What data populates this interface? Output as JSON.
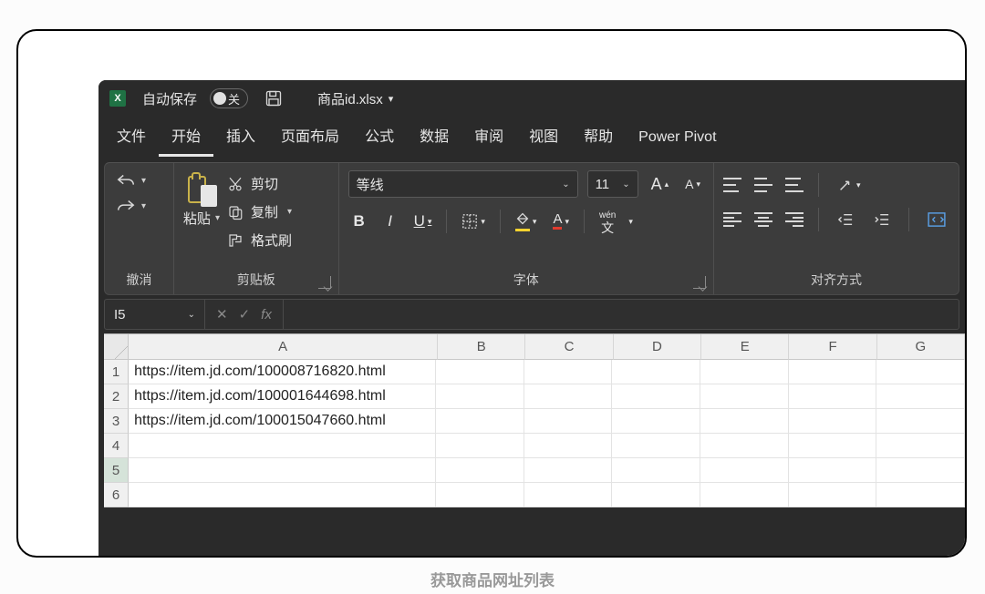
{
  "titlebar": {
    "autosave_label": "自动保存",
    "autosave_state": "关",
    "filename": "商品id.xlsx"
  },
  "tabs": [
    "文件",
    "开始",
    "插入",
    "页面布局",
    "公式",
    "数据",
    "审阅",
    "视图",
    "帮助",
    "Power Pivot"
  ],
  "active_tab": "开始",
  "ribbon": {
    "undo_group": "撤消",
    "clipboard": {
      "paste": "粘贴",
      "cut": "剪切",
      "copy": "复制",
      "format_painter": "格式刷",
      "group": "剪贴板"
    },
    "font": {
      "name": "等线",
      "size": "11",
      "phonetic": "wén",
      "group": "字体"
    },
    "alignment": {
      "group": "对齐方式"
    }
  },
  "formula_bar": {
    "cell_ref": "I5",
    "fx": "fx",
    "value": ""
  },
  "columns": [
    "A",
    "B",
    "C",
    "D",
    "E",
    "F",
    "G"
  ],
  "rows": [
    {
      "n": 1,
      "A": "https://item.jd.com/100008716820.html"
    },
    {
      "n": 2,
      "A": "https://item.jd.com/100001644698.html"
    },
    {
      "n": 3,
      "A": "https://item.jd.com/100015047660.html"
    },
    {
      "n": 4,
      "A": ""
    },
    {
      "n": 5,
      "A": ""
    },
    {
      "n": 6,
      "A": ""
    }
  ],
  "caption": "获取商品网址列表"
}
